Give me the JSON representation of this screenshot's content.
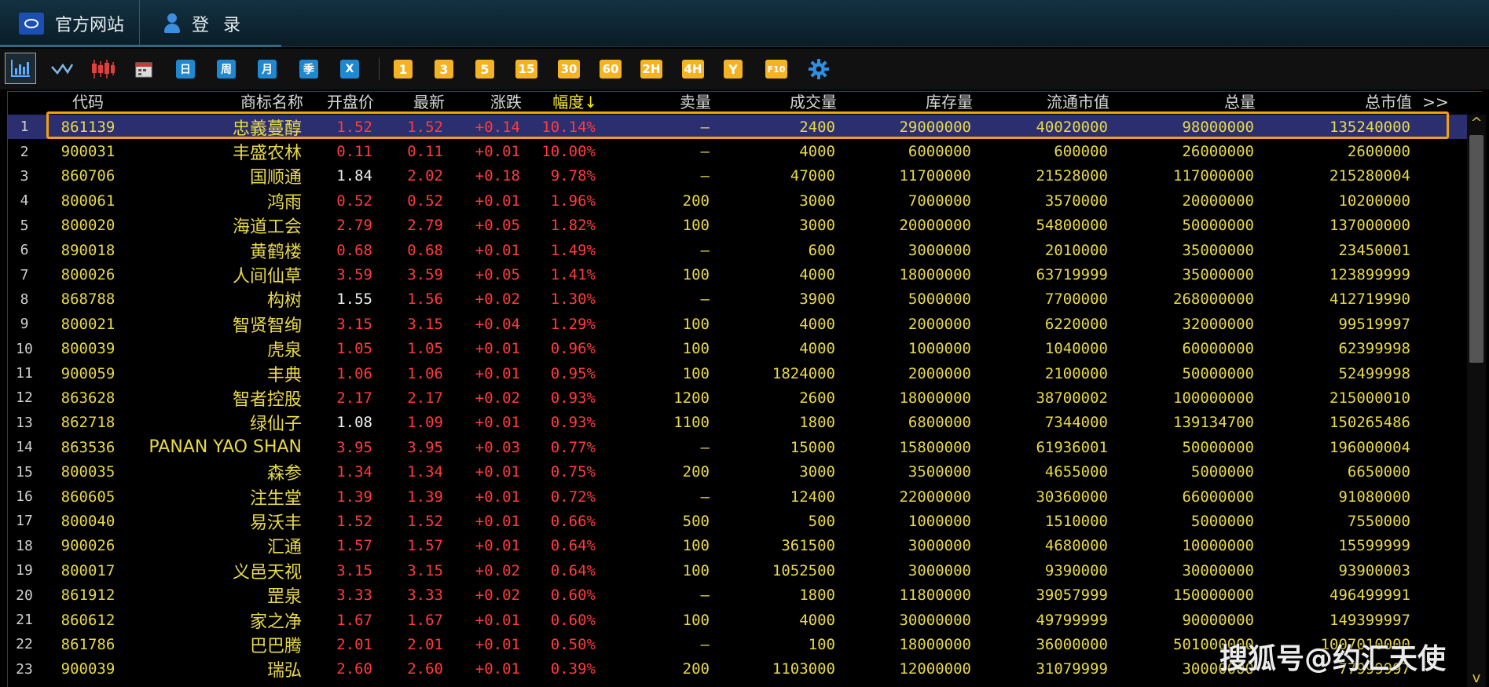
{
  "topbar": {
    "site_label": "官方网站",
    "login_label": "登录"
  },
  "toolbar": {
    "left_icons": [
      "bar-chart-icon",
      "line-chart-icon",
      "candlestick-icon",
      "calendar-icon"
    ],
    "period_buttons": [
      "日",
      "周",
      "月",
      "季",
      "X"
    ],
    "minute_buttons": [
      "1",
      "3",
      "5",
      "15",
      "30",
      "60",
      "2H",
      "4H",
      "Y",
      "F10"
    ],
    "colors": {
      "period": "#1e88d0",
      "minute": "#f5b324"
    }
  },
  "table": {
    "headers": {
      "code": "代码",
      "name": "商标名称",
      "open": "开盘价",
      "last": "最新",
      "change": "涨跌",
      "pct": "幅度↓",
      "sell": "卖量",
      "volume": "成交量",
      "stock": "库存量",
      "float_value": "流通市值",
      "total": "总量",
      "market_cap": "总市值",
      "more": ">>"
    },
    "selected_row": 1,
    "rows": [
      {
        "idx": "1",
        "code": "861139",
        "name": "忠義蔓醇",
        "open": "1.52",
        "last": "1.52",
        "change": "+0.14",
        "pct": "10.14%",
        "sell": "—",
        "volume": "2400",
        "stock": "29000000",
        "float_value": "40020000",
        "total": "98000000",
        "market_cap": "135240000"
      },
      {
        "idx": "2",
        "code": "900031",
        "name": "丰盛农林",
        "open": "0.11",
        "last": "0.11",
        "change": "+0.01",
        "pct": "10.00%",
        "sell": "—",
        "volume": "4000",
        "stock": "6000000",
        "float_value": "600000",
        "total": "26000000",
        "market_cap": "2600000"
      },
      {
        "idx": "3",
        "code": "860706",
        "name": "国顺通",
        "open": "1.84",
        "last": "2.02",
        "change": "+0.18",
        "pct": "9.78%",
        "sell": "—",
        "volume": "47000",
        "stock": "11700000",
        "float_value": "21528000",
        "total": "117000000",
        "market_cap": "215280004"
      },
      {
        "idx": "4",
        "code": "800061",
        "name": "鸿雨",
        "open": "0.52",
        "last": "0.52",
        "change": "+0.01",
        "pct": "1.96%",
        "sell": "200",
        "volume": "3000",
        "stock": "7000000",
        "float_value": "3570000",
        "total": "20000000",
        "market_cap": "10200000"
      },
      {
        "idx": "5",
        "code": "800020",
        "name": "海道工会",
        "open": "2.79",
        "last": "2.79",
        "change": "+0.05",
        "pct": "1.82%",
        "sell": "100",
        "volume": "3000",
        "stock": "20000000",
        "float_value": "54800000",
        "total": "50000000",
        "market_cap": "137000000"
      },
      {
        "idx": "6",
        "code": "890018",
        "name": "黄鹤楼",
        "open": "0.68",
        "last": "0.68",
        "change": "+0.01",
        "pct": "1.49%",
        "sell": "—",
        "volume": "600",
        "stock": "3000000",
        "float_value": "2010000",
        "total": "35000000",
        "market_cap": "23450001"
      },
      {
        "idx": "7",
        "code": "800026",
        "name": "人间仙草",
        "open": "3.59",
        "last": "3.59",
        "change": "+0.05",
        "pct": "1.41%",
        "sell": "100",
        "volume": "4000",
        "stock": "18000000",
        "float_value": "63719999",
        "total": "35000000",
        "market_cap": "123899999"
      },
      {
        "idx": "8",
        "code": "868788",
        "name": "构树",
        "open": "1.55",
        "last": "1.56",
        "change": "+0.02",
        "pct": "1.30%",
        "sell": "—",
        "volume": "3900",
        "stock": "5000000",
        "float_value": "7700000",
        "total": "268000000",
        "market_cap": "412719990"
      },
      {
        "idx": "9",
        "code": "800021",
        "name": "智贤智绚",
        "open": "3.15",
        "last": "3.15",
        "change": "+0.04",
        "pct": "1.29%",
        "sell": "100",
        "volume": "4000",
        "stock": "2000000",
        "float_value": "6220000",
        "total": "32000000",
        "market_cap": "99519997"
      },
      {
        "idx": "10",
        "code": "800039",
        "name": "虎泉",
        "open": "1.05",
        "last": "1.05",
        "change": "+0.01",
        "pct": "0.96%",
        "sell": "100",
        "volume": "4000",
        "stock": "1000000",
        "float_value": "1040000",
        "total": "60000000",
        "market_cap": "62399998"
      },
      {
        "idx": "11",
        "code": "900059",
        "name": "丰典",
        "open": "1.06",
        "last": "1.06",
        "change": "+0.01",
        "pct": "0.95%",
        "sell": "100",
        "volume": "1824000",
        "stock": "2000000",
        "float_value": "2100000",
        "total": "50000000",
        "market_cap": "52499998"
      },
      {
        "idx": "12",
        "code": "863628",
        "name": "智者控股",
        "open": "2.17",
        "last": "2.17",
        "change": "+0.02",
        "pct": "0.93%",
        "sell": "1200",
        "volume": "2600",
        "stock": "18000000",
        "float_value": "38700002",
        "total": "100000000",
        "market_cap": "215000010"
      },
      {
        "idx": "13",
        "code": "862718",
        "name": "绿仙子",
        "open": "1.08",
        "last": "1.09",
        "change": "+0.01",
        "pct": "0.93%",
        "sell": "1100",
        "volume": "1800",
        "stock": "6800000",
        "float_value": "7344000",
        "total": "139134700",
        "market_cap": "150265486"
      },
      {
        "idx": "14",
        "code": "863536",
        "name": "PANAN YAO SHAN",
        "open": "3.95",
        "last": "3.95",
        "change": "+0.03",
        "pct": "0.77%",
        "sell": "—",
        "volume": "15000",
        "stock": "15800000",
        "float_value": "61936001",
        "total": "50000000",
        "market_cap": "196000004"
      },
      {
        "idx": "15",
        "code": "800035",
        "name": "森参",
        "open": "1.34",
        "last": "1.34",
        "change": "+0.01",
        "pct": "0.75%",
        "sell": "200",
        "volume": "3000",
        "stock": "3500000",
        "float_value": "4655000",
        "total": "5000000",
        "market_cap": "6650000"
      },
      {
        "idx": "16",
        "code": "860605",
        "name": "注生堂",
        "open": "1.39",
        "last": "1.39",
        "change": "+0.01",
        "pct": "0.72%",
        "sell": "—",
        "volume": "12400",
        "stock": "22000000",
        "float_value": "30360000",
        "total": "66000000",
        "market_cap": "91080000"
      },
      {
        "idx": "17",
        "code": "800040",
        "name": "易沃丰",
        "open": "1.52",
        "last": "1.52",
        "change": "+0.01",
        "pct": "0.66%",
        "sell": "500",
        "volume": "500",
        "stock": "1000000",
        "float_value": "1510000",
        "total": "5000000",
        "market_cap": "7550000"
      },
      {
        "idx": "18",
        "code": "900026",
        "name": "汇通",
        "open": "1.57",
        "last": "1.57",
        "change": "+0.01",
        "pct": "0.64%",
        "sell": "100",
        "volume": "361500",
        "stock": "3000000",
        "float_value": "4680000",
        "total": "10000000",
        "market_cap": "15599999"
      },
      {
        "idx": "19",
        "code": "800017",
        "name": "义邑天视",
        "open": "3.15",
        "last": "3.15",
        "change": "+0.02",
        "pct": "0.64%",
        "sell": "100",
        "volume": "1052500",
        "stock": "3000000",
        "float_value": "9390000",
        "total": "30000000",
        "market_cap": "93900003"
      },
      {
        "idx": "20",
        "code": "861912",
        "name": "罡泉",
        "open": "3.33",
        "last": "3.33",
        "change": "+0.02",
        "pct": "0.60%",
        "sell": "—",
        "volume": "1800",
        "stock": "11800000",
        "float_value": "39057999",
        "total": "150000000",
        "market_cap": "496499991"
      },
      {
        "idx": "21",
        "code": "860612",
        "name": "家之净",
        "open": "1.67",
        "last": "1.67",
        "change": "+0.01",
        "pct": "0.60%",
        "sell": "100",
        "volume": "4000",
        "stock": "30000000",
        "float_value": "49799999",
        "total": "90000000",
        "market_cap": "149399997"
      },
      {
        "idx": "22",
        "code": "861786",
        "name": "巴巴腾",
        "open": "2.01",
        "last": "2.01",
        "change": "+0.01",
        "pct": "0.50%",
        "sell": "—",
        "volume": "100",
        "stock": "18000000",
        "float_value": "36000000",
        "total": "501000000",
        "market_cap": "1007010000"
      },
      {
        "idx": "23",
        "code": "900039",
        "name": "瑞弘",
        "open": "2.60",
        "last": "2.60",
        "change": "+0.01",
        "pct": "0.39%",
        "sell": "200",
        "volume": "1103000",
        "stock": "12000000",
        "float_value": "31079999",
        "total": "30000000",
        "market_cap": "77999997"
      }
    ]
  },
  "watermark": "搜狐号@约汇天使"
}
